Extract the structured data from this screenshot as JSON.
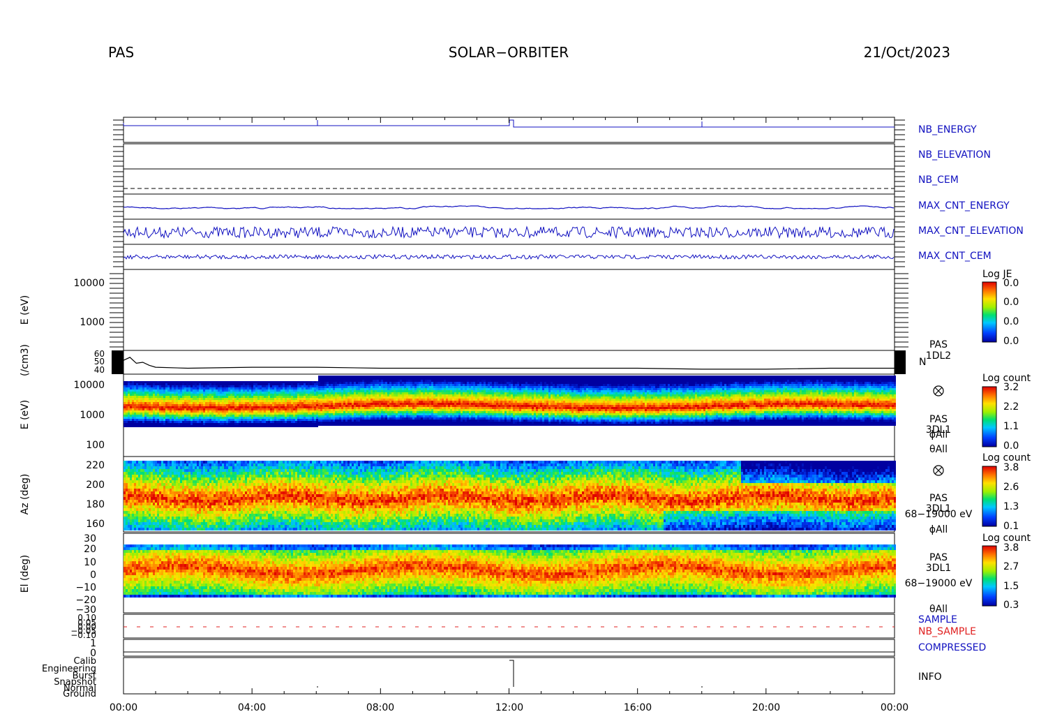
{
  "header": {
    "instrument": "PAS",
    "mission": "SOLAR−ORBITER",
    "date": "21/Oct/2023"
  },
  "chart_data": [
    {
      "type": "line",
      "panel": "housekeeping",
      "series": [
        {
          "name": "NB_ENERGY",
          "color": "#1010c0"
        },
        {
          "name": "NB_ELEVATION",
          "color": "#1010c0"
        },
        {
          "name": "NB_CEM",
          "color": "#1010c0"
        },
        {
          "name": "MAX_CNT_ENERGY",
          "color": "#1010c0"
        },
        {
          "name": "MAX_CNT_ELEVATION",
          "color": "#1010c0"
        },
        {
          "name": "MAX_CNT_CEM",
          "color": "#1010c0"
        }
      ]
    },
    {
      "type": "heatmap",
      "panel": "PAS 1DL2 energy",
      "ylabel": "E (eV)",
      "yticks": [
        "10000",
        "1000"
      ],
      "colorbar": {
        "title": "Log JE",
        "ticks": [
          "0.0",
          "0.0",
          "0.0",
          "0.0"
        ]
      }
    },
    {
      "type": "line",
      "panel": "density",
      "ylabel": "(/cm3)",
      "yticks": [
        "60",
        "50",
        "40"
      ],
      "series_label": "N",
      "label_lines": [
        "PAS",
        "1DL2"
      ],
      "x": [
        0,
        0.2,
        0.4,
        0.6,
        0.8,
        1,
        2,
        4,
        6,
        8,
        10,
        12,
        14,
        16,
        18,
        20,
        22,
        24
      ],
      "values": [
        52,
        55,
        49,
        50,
        47,
        45,
        44,
        45,
        45,
        44,
        44,
        44,
        44,
        44,
        43,
        43,
        44,
        44
      ]
    },
    {
      "type": "heatmap",
      "panel": "PAS 3DL1 energy",
      "ylabel": "E (eV)",
      "yticks": [
        "10000",
        "1000",
        "100"
      ],
      "label_lines": [
        "PAS",
        "3DL1",
        "ϕAll",
        "θAll"
      ],
      "colorbar": {
        "title": "Log count",
        "ticks": [
          "3.2",
          "2.2",
          "1.1",
          "0.0"
        ]
      }
    },
    {
      "type": "heatmap",
      "panel": "PAS 3DL1 azimuth",
      "ylabel": "Az (deg)",
      "yticks": [
        "220",
        "200",
        "180",
        "160"
      ],
      "label_lines": [
        "PAS",
        "3DL1",
        "68−19000 eV",
        "ϕAll"
      ],
      "colorbar": {
        "title": "Log count",
        "ticks": [
          "3.8",
          "2.6",
          "1.3",
          "0.1"
        ]
      }
    },
    {
      "type": "heatmap",
      "panel": "PAS 3DL1 elevation",
      "ylabel": "El (deg)",
      "yticks": [
        "30",
        "20",
        "10",
        "0",
        "−10",
        "−20",
        "−30"
      ],
      "label_lines": [
        "PAS",
        "3DL1",
        "68−19000 eV",
        "θAll"
      ],
      "colorbar": {
        "title": "Log count",
        "ticks": [
          "3.8",
          "2.7",
          "1.5",
          "0.3"
        ]
      }
    },
    {
      "type": "line",
      "panel": "sample",
      "yticks": [
        "0.10",
        "0.05",
        "0.00",
        "−0.05",
        "−0.10"
      ],
      "series": [
        {
          "name": "SAMPLE",
          "color": "#1010c0"
        },
        {
          "name": "NB_SAMPLE",
          "color": "#e02020"
        }
      ]
    },
    {
      "type": "line",
      "panel": "compressed",
      "yticks": [
        "1",
        "0"
      ],
      "series": [
        {
          "name": "COMPRESSED",
          "color": "#1010c0"
        }
      ]
    },
    {
      "type": "line",
      "panel": "info",
      "yticks": [
        "Calib",
        "Engineering",
        "Burst",
        "Snapshot",
        "Normal",
        "Ground"
      ],
      "series": [
        {
          "name": "INFO",
          "color": "#000000"
        }
      ]
    }
  ],
  "xaxis": {
    "ticks": [
      "00:00",
      "04:00",
      "08:00",
      "12:00",
      "16:00",
      "20:00",
      "00:00"
    ]
  }
}
